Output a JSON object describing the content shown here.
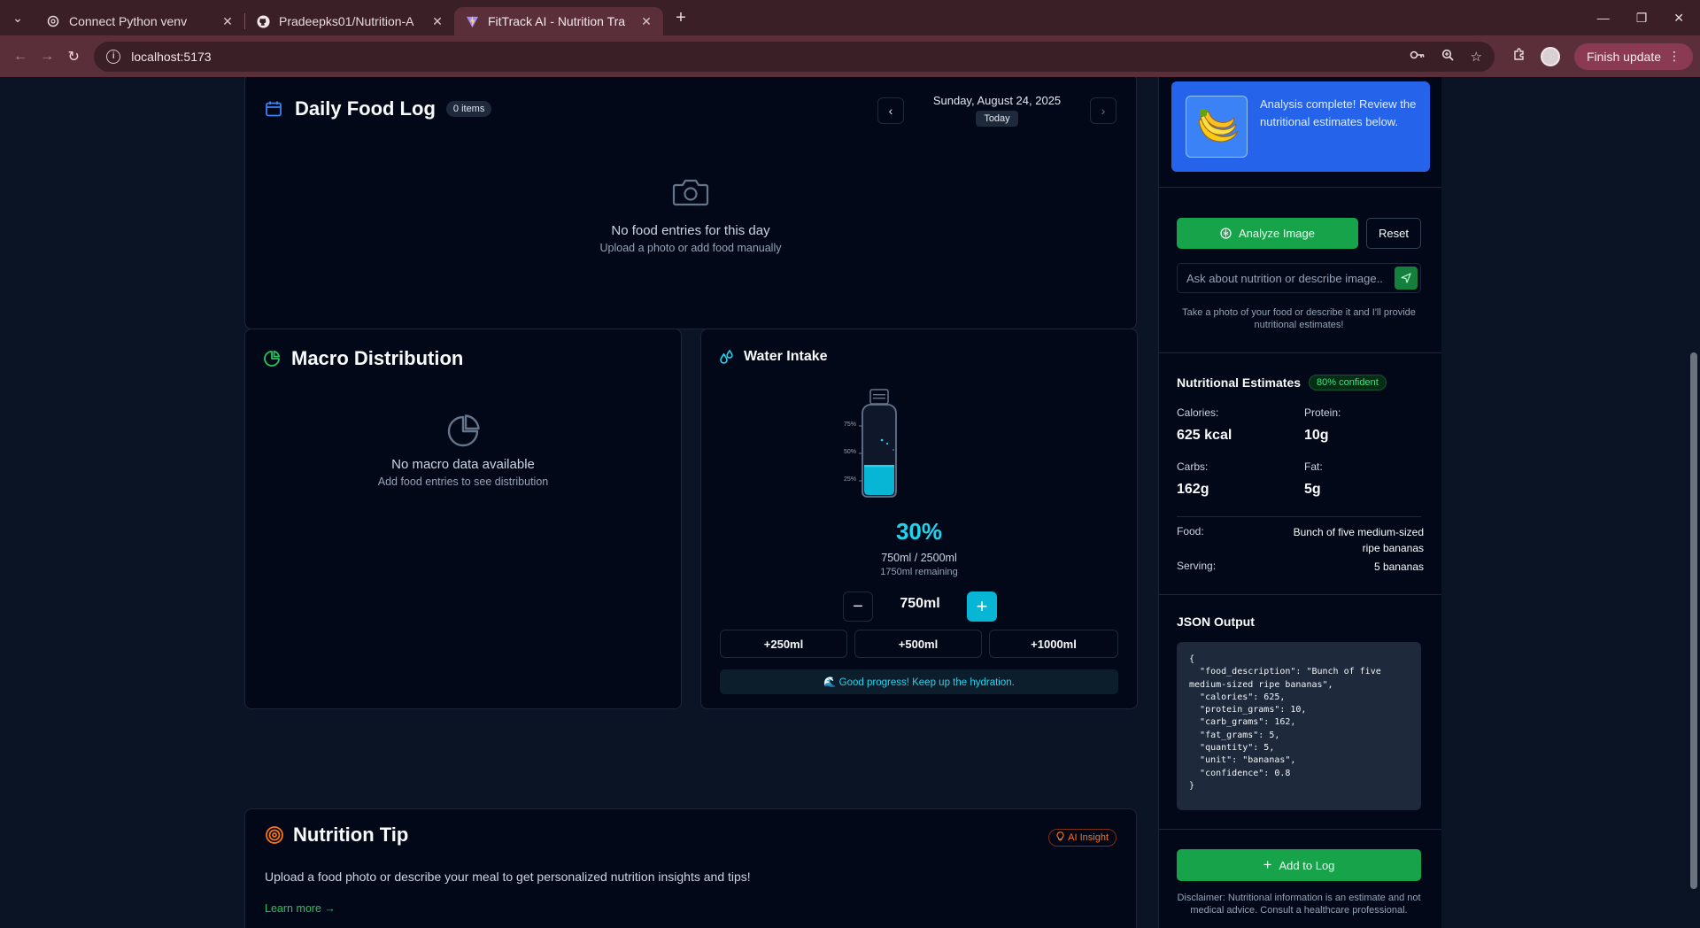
{
  "browser": {
    "tabs": [
      {
        "title": "Connect Python venv",
        "icon": "openai-icon"
      },
      {
        "title": "Pradeepks01/Nutrition-A",
        "icon": "github-icon"
      },
      {
        "title": "FitTrack AI - Nutrition Tra",
        "icon": "vite-icon",
        "active": true
      }
    ],
    "url": "localhost:5173",
    "finish_update": "Finish update"
  },
  "food_log": {
    "title": "Daily Food Log",
    "items_badge": "0 items",
    "date": "Sunday, August 24, 2025",
    "today_label": "Today",
    "empty_title": "No food entries for this day",
    "empty_subtitle": "Upload a photo or add food manually"
  },
  "macro": {
    "title": "Macro Distribution",
    "empty_title": "No macro data available",
    "empty_subtitle": "Add food entries to see distribution"
  },
  "water": {
    "title": "Water Intake",
    "ticks": [
      "75%",
      "50%",
      "25%"
    ],
    "fill_fraction": 0.3,
    "percent": "30%",
    "amount": "750ml / 2500ml",
    "remaining": "1750ml remaining",
    "stepper_value": "750ml",
    "quick_add": [
      "+250ml",
      "+500ml",
      "+1000ml"
    ],
    "message": "🌊 Good progress! Keep up the hydration."
  },
  "tip": {
    "title": "Nutrition Tip",
    "badge": "AI Insight",
    "text": "Upload a food photo or describe your meal to get personalized nutrition insights and tips!",
    "link": "Learn more →"
  },
  "analysis": {
    "status": "Analysis complete! Review the nutritional estimates below.",
    "analyze_button": "Analyze Image",
    "reset_button": "Reset",
    "chat_placeholder": "Ask about nutrition or describe image...",
    "hint": "Take a photo of your food or describe it and I'll provide nutritional estimates!"
  },
  "estimates": {
    "title": "Nutritional Estimates",
    "confidence": "80% confident",
    "calories_label": "Calories:",
    "calories_value": "625 kcal",
    "protein_label": "Protein:",
    "protein_value": "10g",
    "carbs_label": "Carbs:",
    "carbs_value": "162g",
    "fat_label": "Fat:",
    "fat_value": "5g",
    "food_label": "Food:",
    "food_value": "Bunch of five medium-sized ripe bananas",
    "serving_label": "Serving:",
    "serving_value": "5 bananas"
  },
  "json_output": {
    "title": "JSON Output",
    "text": "{\n  \"food_description\": \"Bunch of five medium-sized ripe bananas\",\n  \"calories\": 625,\n  \"protein_grams\": 10,\n  \"carb_grams\": 162,\n  \"fat_grams\": 5,\n  \"quantity\": 5,\n  \"unit\": \"bananas\",\n  \"confidence\": 0.8\n}"
  },
  "add_to_log": "Add to Log",
  "disclaimer": "Disclaimer: Nutritional information is an estimate and not medical advice. Consult a healthcare professional.",
  "colors": {
    "accent_blue": "#2563eb",
    "accent_green": "#16a34a",
    "water_cyan": "#06b6d4",
    "tip_orange": "#f97316"
  }
}
